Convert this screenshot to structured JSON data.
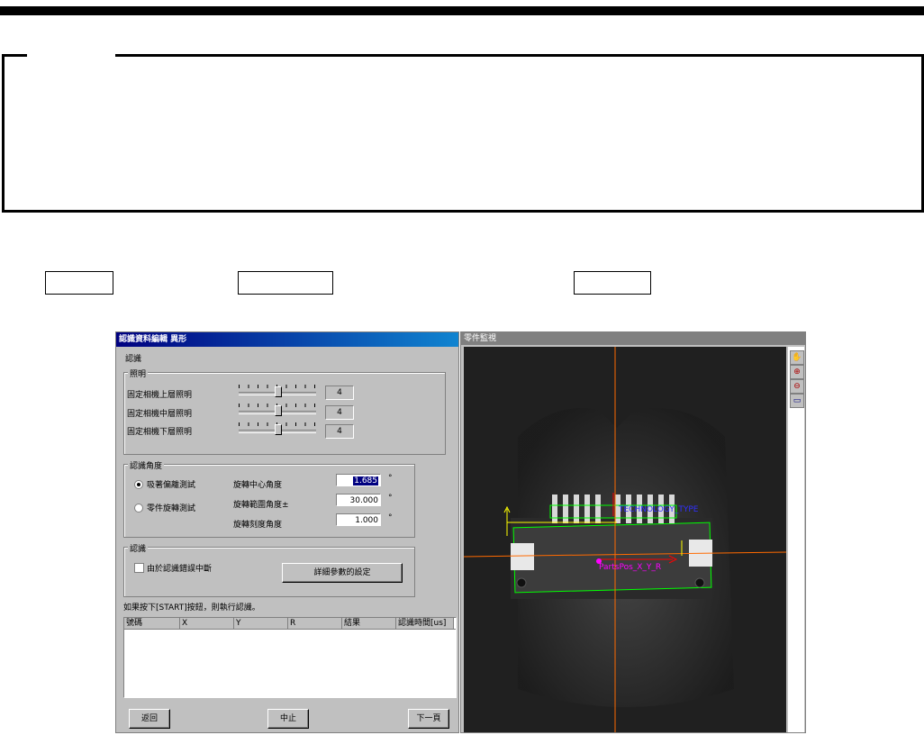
{
  "dialog": {
    "title": "認識資料編輯 異形",
    "section_label": "認識",
    "lighting": {
      "title": "照明",
      "rows": [
        {
          "label": "固定相機上層照明",
          "value": "4"
        },
        {
          "label": "固定相機中層照明",
          "value": "4"
        },
        {
          "label": "固定相機下層照明",
          "value": "4"
        }
      ]
    },
    "angle": {
      "title": "認識角度",
      "options": [
        "吸著偏離測試",
        "零件旋轉測試"
      ],
      "selected_option": "吸著偏離測試",
      "fields": [
        {
          "label": "旋轉中心角度",
          "value": "1.685",
          "unit": "°"
        },
        {
          "label": "旋轉範圍角度±",
          "value": "30.000",
          "unit": "°"
        },
        {
          "label": "旋轉刻度角度",
          "value": "1.000",
          "unit": "°"
        }
      ]
    },
    "recog": {
      "title": "認識",
      "checkbox_label": "由於認識錯誤中斷",
      "checkbox_checked": false,
      "detail_button": "詳細參數的設定"
    },
    "hint": "如果按下[START]按鈕，則執行認識。",
    "table": {
      "columns": [
        "號碼",
        "X",
        "Y",
        "R",
        "結果",
        "認識時間[us]"
      ],
      "rows": []
    },
    "buttons": {
      "back": "返回",
      "stop": "中止",
      "next": "下一頁"
    }
  },
  "monitor": {
    "title": "零件監視",
    "labels": {
      "top": "TECHNOLOGY_TYPE",
      "bottom": "PartsPos_X_Y_R"
    },
    "tools": [
      "hand-icon",
      "zoom-in-icon",
      "zoom-out-icon",
      "monitor-icon"
    ]
  },
  "colors": {
    "titlebar": "#000080",
    "crosshair": "#ff6a00",
    "outline": "#00ff00",
    "label_blue": "#3030ff",
    "label_magenta": "#ff00ff"
  }
}
